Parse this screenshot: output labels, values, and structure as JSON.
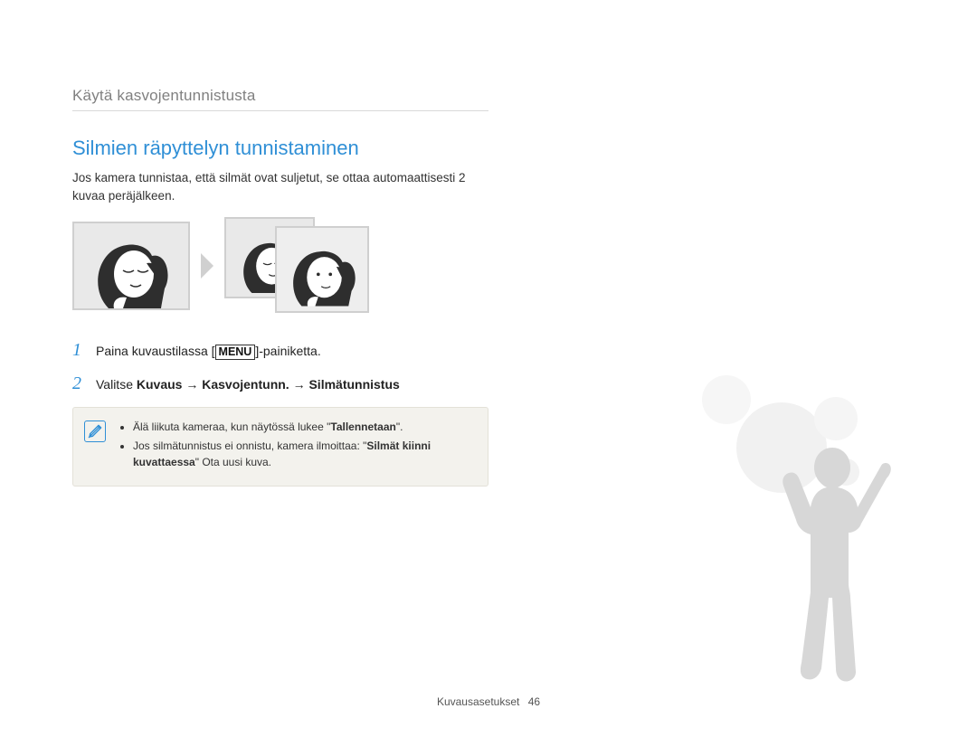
{
  "breadcrumb": "Käytä kasvojentunnistusta",
  "section_title": "Silmien räpyttelyn tunnistaminen",
  "intro": "Jos kamera tunnistaa, että silmät ovat suljetut, se ottaa automaattisesti 2 kuvaa peräjälkeen.",
  "steps": [
    {
      "num": "1",
      "prefix": "Paina kuvaustilassa [",
      "menu": "MENU",
      "suffix": "]-painiketta."
    },
    {
      "num": "2",
      "prefix": "Valitse ",
      "bold": "Kuvaus → Kasvojentunn. → Silmätunnistus"
    }
  ],
  "notes": [
    {
      "pre": "Älä liikuta kameraa, kun näytössä lukee \"",
      "bold": "Tallennetaan",
      "post": "\"."
    },
    {
      "pre": "Jos silmätunnistus ei onnistu, kamera ilmoittaa: \"",
      "bold": "Silmät kiinni kuvattaessa",
      "post": "\" Ota uusi kuva."
    }
  ],
  "footer": {
    "label": "Kuvausasetukset",
    "page": "46"
  }
}
